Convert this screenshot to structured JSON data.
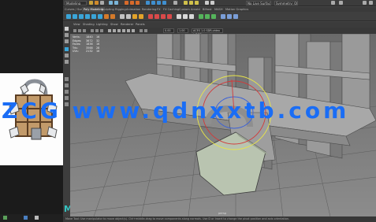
{
  "menubar": {
    "mode": "Modeling",
    "search": "Search",
    "no_live_surface": "No Live Surface",
    "symmetry": "Symmetry: Off"
  },
  "shelf_tabs": [
    "Curves / Surfaces",
    "Poly Modeling",
    "Sculpting",
    "Rigging",
    "Animation",
    "Rendering",
    "FX",
    "FX Caching",
    "Custom",
    "Arnold",
    "Bifrost",
    "MASH",
    "Motion Graphics"
  ],
  "active_shelf_tab": "Poly Modeling",
  "panel_menu": [
    "View",
    "Shading",
    "Lighting",
    "Show",
    "Renderer",
    "Panels"
  ],
  "panel_bar": {
    "field_value": "0.00",
    "field_value_2": "1.00",
    "color_space": "ACES 1.0 SDR-video (sRGB)"
  },
  "hud": {
    "rows": [
      [
        "Verts:",
        "1840",
        "16"
      ],
      [
        "Edges:",
        "3672",
        "32"
      ],
      [
        "Faces:",
        "1836",
        "16"
      ],
      [
        "Tris:",
        "3568",
        "28"
      ],
      [
        "UVs:",
        "2132",
        "16"
      ]
    ]
  },
  "viewport": {
    "camera_label": "persp"
  },
  "helpline": "Move Tool: Use manipulator to move object(s). Ctrl+middle-drag to move components along normals. Use D or Insert to change the pivot position and axis orientation.",
  "watermark": "ZCG www.qdnxxtb.com",
  "colors": {
    "maya_accent": "#35c4c2",
    "watermark": "#1a6df5",
    "manipulator_yellow": "#e8e54a",
    "manipulator_red": "#d23a3a"
  }
}
